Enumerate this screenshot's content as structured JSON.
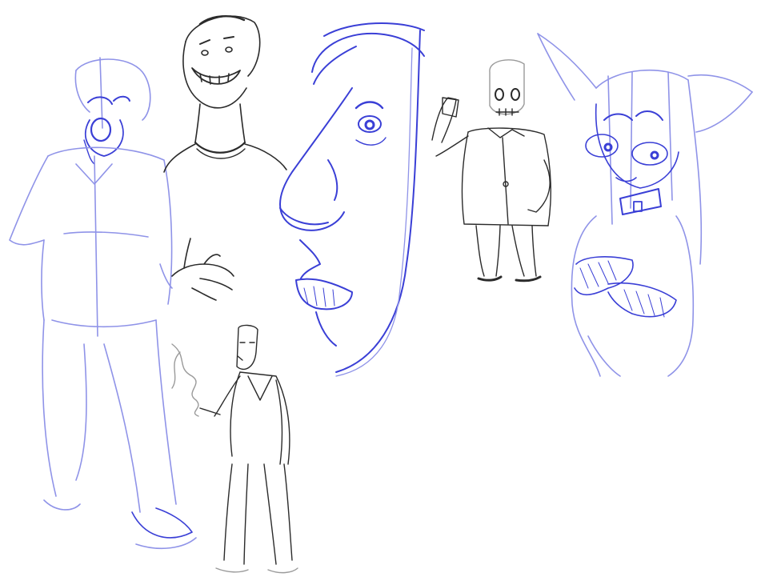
{
  "image": {
    "kind": "sketch-sheet",
    "background_color": "#ffffff",
    "ink_colors": {
      "blue": "#3a3fd6",
      "light_blue": "#8f93e8",
      "dark": "#2b2b2b",
      "grey": "#9a9a9a"
    },
    "figures": [
      "bearded-man-figure",
      "grinning-man-figure",
      "long-face-profile",
      "skull-man-in-suit-figure",
      "cat-eared-girl-figure",
      "smoking-man-in-suit-figure"
    ]
  }
}
